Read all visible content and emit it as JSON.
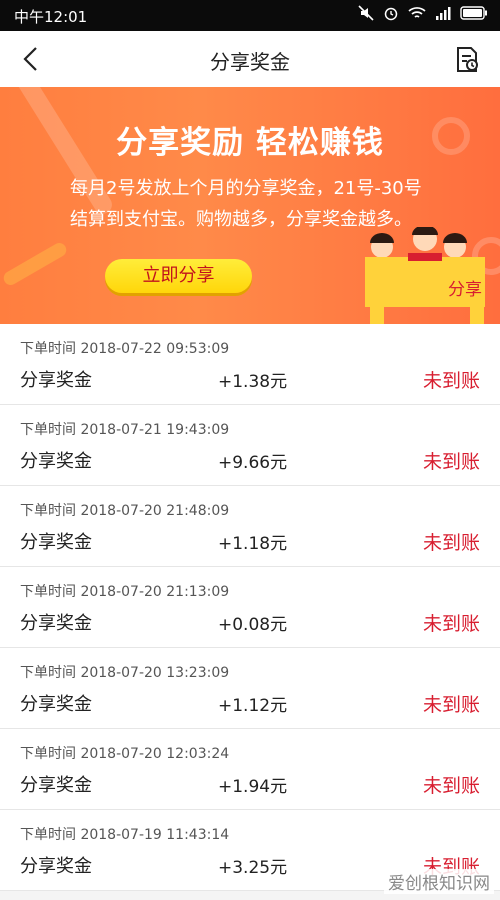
{
  "status_bar": {
    "time": "中午12:01"
  },
  "nav": {
    "title": "分享奖金"
  },
  "banner": {
    "headline": "分享奖励 轻松赚钱",
    "desc_line1": "每月2号发放上个月的分享奖金，21号-30号",
    "desc_line2": "结算到支付宝。购物越多，分享奖金越多。",
    "button_label": "立即分享",
    "illustration_book_text": "分享"
  },
  "records": [
    {
      "time": "下单时间 2018-07-22 09:53:09",
      "name": "分享奖金",
      "amount": "+1.38元",
      "status": "未到账"
    },
    {
      "time": "下单时间 2018-07-21 19:43:09",
      "name": "分享奖金",
      "amount": "+9.66元",
      "status": "未到账"
    },
    {
      "time": "下单时间 2018-07-20 21:48:09",
      "name": "分享奖金",
      "amount": "+1.18元",
      "status": "未到账"
    },
    {
      "time": "下单时间 2018-07-20 21:13:09",
      "name": "分享奖金",
      "amount": "+0.08元",
      "status": "未到账"
    },
    {
      "time": "下单时间 2018-07-20 13:23:09",
      "name": "分享奖金",
      "amount": "+1.12元",
      "status": "未到账"
    },
    {
      "time": "下单时间 2018-07-20 12:03:24",
      "name": "分享奖金",
      "amount": "+1.94元",
      "status": "未到账"
    },
    {
      "time": "下单时间 2018-07-19 11:43:14",
      "name": "分享奖金",
      "amount": "+3.25元",
      "status": "未到账"
    }
  ],
  "watermark": "爱创根知识网",
  "colors": {
    "status_red": "#d81e30",
    "banner_orange": "#ff7e3f",
    "button_yellow": "#ffe22a"
  }
}
